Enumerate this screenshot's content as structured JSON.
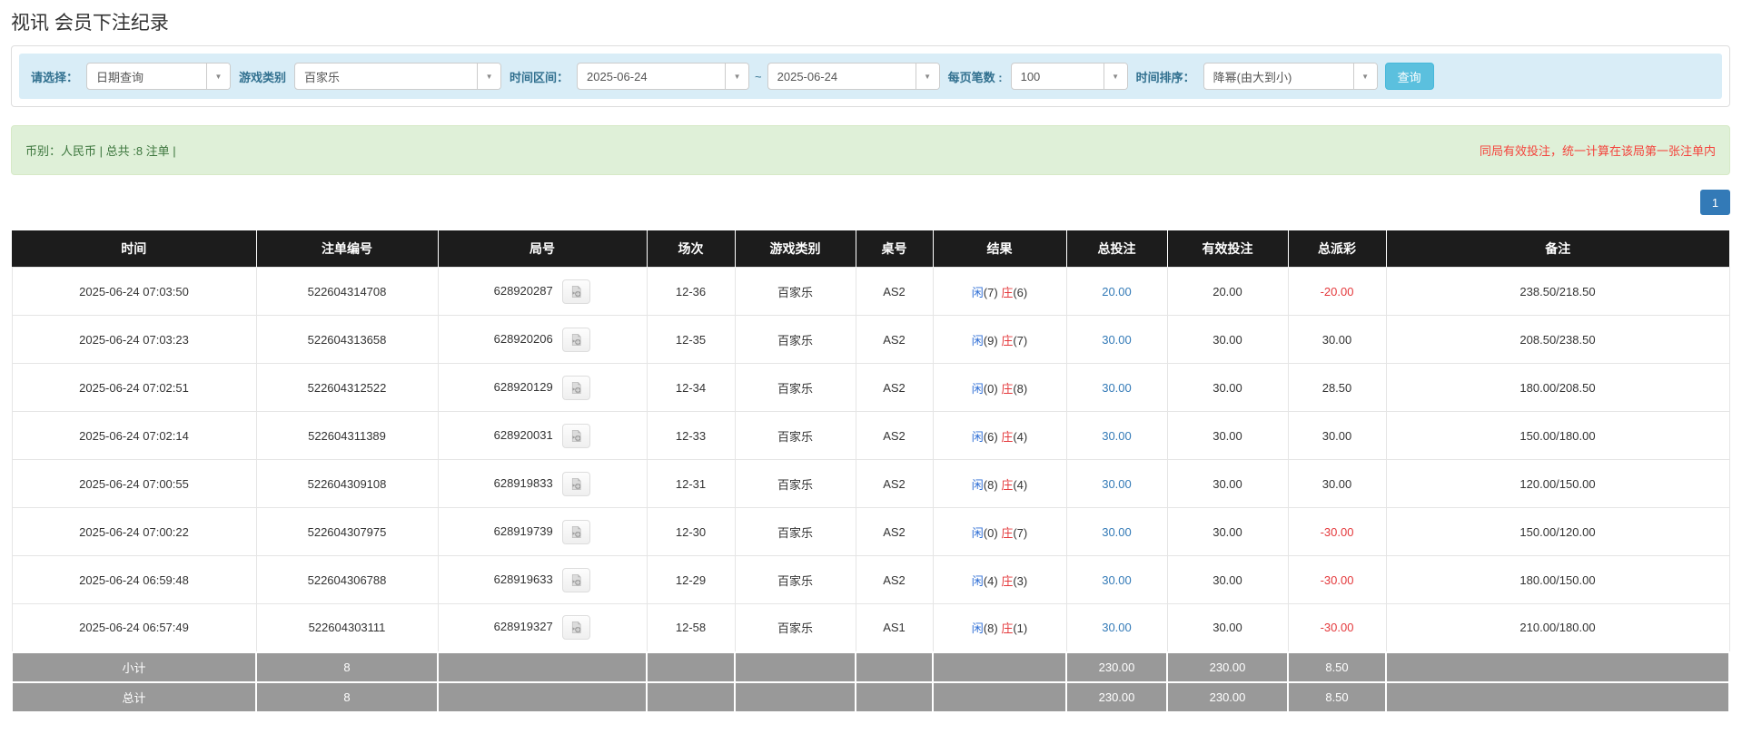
{
  "page": {
    "title": "视讯 会员下注纪录"
  },
  "icons": {
    "caret": "▼",
    "video": "video-file-icon"
  },
  "colors": {
    "header_bg": "#1c1c1c",
    "footer_bg": "#999999",
    "filter_bar_bg": "#d9edf7",
    "summary_bar_bg": "#dff0d8",
    "summary_text": "#3c763d",
    "note_red": "#f4433c",
    "search_button": "#5bc0de",
    "pagination_blue": "#337ab7",
    "link_blue": "#337ab7",
    "player_blue": "#2e6ed5",
    "banker_red": "#e4393c",
    "negative_red": "#e4393c"
  },
  "filters": {
    "select_label": "请选择：",
    "select_value": "日期查询",
    "game_type_label": "游戏类别",
    "game_type_value": "百家乐",
    "time_range_label": "时间区间：",
    "date_from": "2025-06-24",
    "tilde": "~",
    "date_to": "2025-06-24",
    "page_size_label": "每页笔数 :",
    "page_size_value": "100",
    "sort_label": "时间排序：",
    "sort_value": "降幂(由大到小)",
    "search_button": "查询"
  },
  "summary": {
    "left_text": "币别：人民币 | 总共 :8 注单 |",
    "right_note": "同局有效投注，统一计算在该局第一张注单内"
  },
  "pagination": {
    "current": "1"
  },
  "table": {
    "headers": [
      "时间",
      "注单编号",
      "局号",
      "场次",
      "游戏类别",
      "桌号",
      "结果",
      "总投注",
      "有效投注",
      "总派彩",
      "备注"
    ],
    "rows": [
      {
        "time": "2025-06-24 07:03:50",
        "bet_id": "522604314708",
        "round": "628920287",
        "session": "12-36",
        "game": "百家乐",
        "table": "AS2",
        "result": {
          "player_label": "闲",
          "player_score": "(7)",
          "banker_label": "庄",
          "banker_score": "(6)"
        },
        "total_bet": "20.00",
        "valid_bet": "20.00",
        "payout": "-20.00",
        "remark": "238.50/218.50"
      },
      {
        "time": "2025-06-24 07:03:23",
        "bet_id": "522604313658",
        "round": "628920206",
        "session": "12-35",
        "game": "百家乐",
        "table": "AS2",
        "result": {
          "player_label": "闲",
          "player_score": "(9)",
          "banker_label": "庄",
          "banker_score": "(7)"
        },
        "total_bet": "30.00",
        "valid_bet": "30.00",
        "payout": "30.00",
        "remark": "208.50/238.50"
      },
      {
        "time": "2025-06-24 07:02:51",
        "bet_id": "522604312522",
        "round": "628920129",
        "session": "12-34",
        "game": "百家乐",
        "table": "AS2",
        "result": {
          "player_label": "闲",
          "player_score": "(0)",
          "banker_label": "庄",
          "banker_score": "(8)"
        },
        "total_bet": "30.00",
        "valid_bet": "30.00",
        "payout": "28.50",
        "remark": "180.00/208.50"
      },
      {
        "time": "2025-06-24 07:02:14",
        "bet_id": "522604311389",
        "round": "628920031",
        "session": "12-33",
        "game": "百家乐",
        "table": "AS2",
        "result": {
          "player_label": "闲",
          "player_score": "(6)",
          "banker_label": "庄",
          "banker_score": "(4)"
        },
        "total_bet": "30.00",
        "valid_bet": "30.00",
        "payout": "30.00",
        "remark": "150.00/180.00"
      },
      {
        "time": "2025-06-24 07:00:55",
        "bet_id": "522604309108",
        "round": "628919833",
        "session": "12-31",
        "game": "百家乐",
        "table": "AS2",
        "result": {
          "player_label": "闲",
          "player_score": "(8)",
          "banker_label": "庄",
          "banker_score": "(4)"
        },
        "total_bet": "30.00",
        "valid_bet": "30.00",
        "payout": "30.00",
        "remark": "120.00/150.00"
      },
      {
        "time": "2025-06-24 07:00:22",
        "bet_id": "522604307975",
        "round": "628919739",
        "session": "12-30",
        "game": "百家乐",
        "table": "AS2",
        "result": {
          "player_label": "闲",
          "player_score": "(0)",
          "banker_label": "庄",
          "banker_score": "(7)"
        },
        "total_bet": "30.00",
        "valid_bet": "30.00",
        "payout": "-30.00",
        "remark": "150.00/120.00"
      },
      {
        "time": "2025-06-24 06:59:48",
        "bet_id": "522604306788",
        "round": "628919633",
        "session": "12-29",
        "game": "百家乐",
        "table": "AS2",
        "result": {
          "player_label": "闲",
          "player_score": "(4)",
          "banker_label": "庄",
          "banker_score": "(3)"
        },
        "total_bet": "30.00",
        "valid_bet": "30.00",
        "payout": "-30.00",
        "remark": "180.00/150.00"
      },
      {
        "time": "2025-06-24 06:57:49",
        "bet_id": "522604303111",
        "round": "628919327",
        "session": "12-58",
        "game": "百家乐",
        "table": "AS1",
        "result": {
          "player_label": "闲",
          "player_score": "(8)",
          "banker_label": "庄",
          "banker_score": "(1)"
        },
        "total_bet": "30.00",
        "valid_bet": "30.00",
        "payout": "-30.00",
        "remark": "210.00/180.00"
      }
    ],
    "subtotal": {
      "label": "小计",
      "count": "8",
      "total_bet": "230.00",
      "valid_bet": "230.00",
      "payout": "8.50"
    },
    "total": {
      "label": "总计",
      "count": "8",
      "total_bet": "230.00",
      "valid_bet": "230.00",
      "payout": "8.50"
    }
  }
}
